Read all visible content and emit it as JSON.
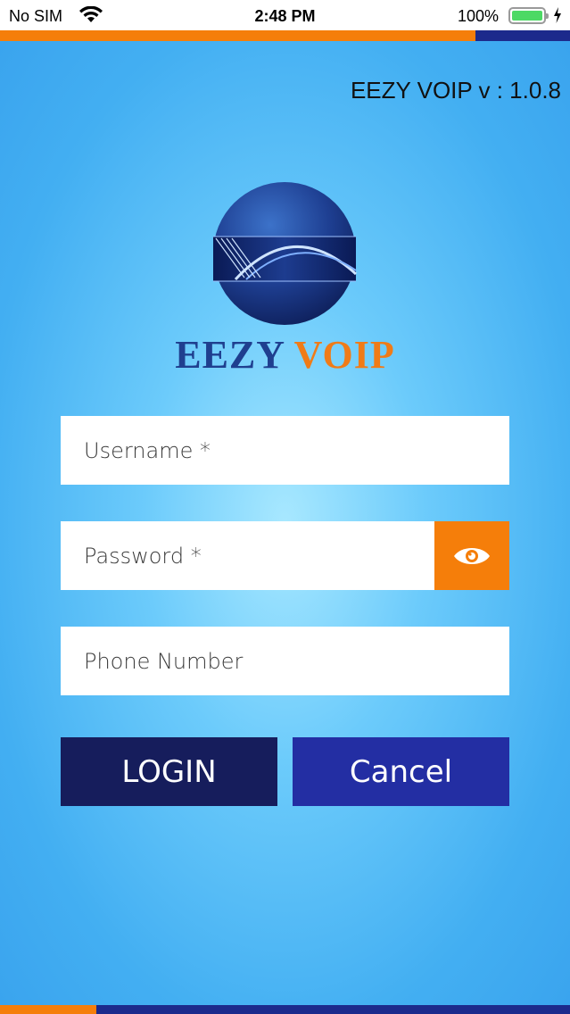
{
  "status_bar": {
    "carrier": "No SIM",
    "time": "2:48 PM",
    "battery_percent": "100%",
    "battery_level": 1.0,
    "icons": [
      "wifi-icon",
      "battery-icon",
      "charging-bolt-icon"
    ]
  },
  "header": {
    "version": "EEZY VOIP v : 1.0.8"
  },
  "brand": {
    "part1": "EEZY",
    "part2": "VOIP",
    "logo_icon": "globe-swoosh-logo"
  },
  "form": {
    "username_placeholder": "Username *",
    "username_value": "",
    "password_placeholder": "Password *",
    "password_value": "",
    "phone_placeholder": "Phone Number",
    "phone_value": "",
    "show_password_icon": "eye-icon"
  },
  "actions": {
    "login_label": "LOGIN",
    "cancel_label": "Cancel"
  },
  "colors": {
    "accent_orange": "#f57e0a",
    "navy": "#1c2a8c",
    "login_bg": "#161d5c",
    "cancel_bg": "#232ea3",
    "brand_blue": "#1f3f8f",
    "brand_orange": "#f07b17",
    "background_light": "#a8e8ff",
    "background_dark": "#3aa4ee"
  }
}
